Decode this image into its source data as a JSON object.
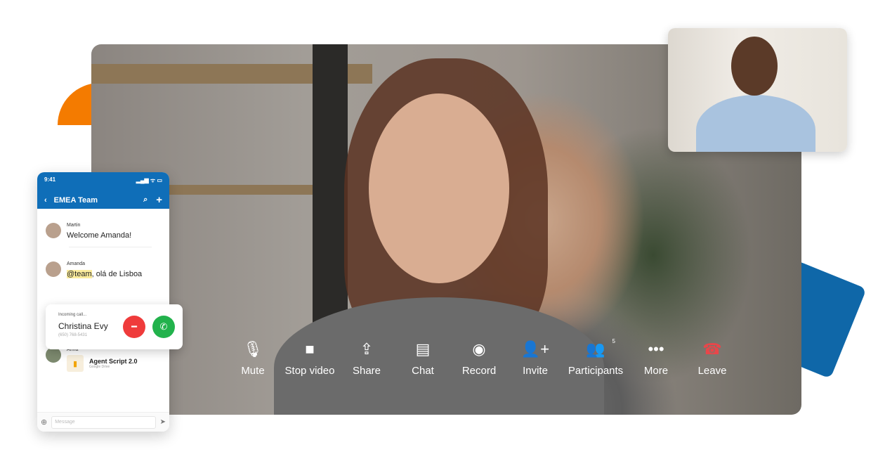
{
  "controls": [
    {
      "label": "Mute",
      "icon": "microphone-icon",
      "glyph": "🎙"
    },
    {
      "label": "Stop video",
      "icon": "video-camera-icon",
      "glyph": "■"
    },
    {
      "label": "Share",
      "icon": "share-screen-icon",
      "glyph": "⇪"
    },
    {
      "label": "Chat",
      "icon": "chat-icon",
      "glyph": "▤"
    },
    {
      "label": "Record",
      "icon": "record-icon",
      "glyph": "◉"
    },
    {
      "label": "Invite",
      "icon": "add-person-icon",
      "glyph": "👤+"
    },
    {
      "label": "Participants",
      "icon": "participants-icon",
      "glyph": "👥",
      "badge": "5"
    },
    {
      "label": "More",
      "icon": "more-icon",
      "glyph": "•••"
    },
    {
      "label": "Leave",
      "icon": "hang-up-icon",
      "glyph": "☎",
      "color": "#e8464a"
    }
  ],
  "phone": {
    "time": "9:41",
    "signal": "▂▄▆ ᯤ ▭",
    "title": "EMEA Team",
    "messages": [
      {
        "name": "Martin",
        "text": "Welcome Amanda!"
      },
      {
        "name": "Amanda",
        "mention": "@team",
        "text": ", olá de Lisboa"
      },
      {
        "name": "Anna",
        "doc_title": "Agent Script 2.0",
        "doc_source": "Google Drive"
      }
    ],
    "placeholder": "Message"
  },
  "call": {
    "label": "Incoming call...",
    "name": "Christina Evy",
    "number": "(650) 768-5431"
  },
  "colors": {
    "brand": "#0f6eb8",
    "accent_orange": "#f47b00",
    "decline": "#ef3b3b",
    "accept": "#22b24c"
  }
}
